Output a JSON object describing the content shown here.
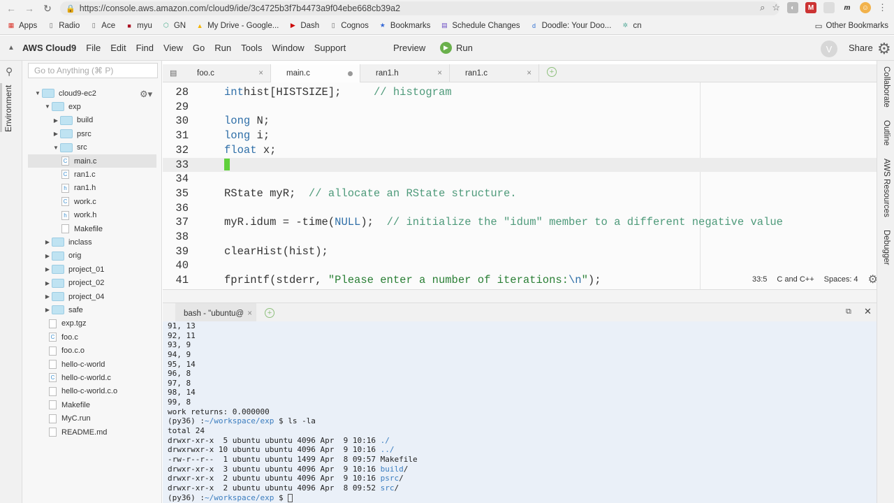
{
  "browser": {
    "url": "https://console.aws.amazon.com/cloud9/ide/3c4725b3f7b4473a9f04ebe668cb39a2",
    "bookmarks": [
      "Apps",
      "Radio",
      "Ace",
      "myu",
      "GN",
      "My Drive - Google...",
      "Dash",
      "Cognos",
      "Bookmarks",
      "Schedule Changes",
      "Doodle: Your Doo...",
      "cn"
    ],
    "other_bookmarks": "Other Bookmarks"
  },
  "menubar": {
    "brand": "AWS Cloud9",
    "menus": [
      "File",
      "Edit",
      "Find",
      "View",
      "Go",
      "Run",
      "Tools",
      "Window",
      "Support"
    ],
    "preview": "Preview",
    "run": "Run",
    "avatar": "V",
    "share": "Share"
  },
  "leftrail": {
    "environment": "Environment"
  },
  "tree": {
    "goto_placeholder": "Go to Anything (⌘ P)",
    "items": [
      {
        "label": "cloud9-ec2",
        "type": "folder",
        "arrow": "▼"
      },
      {
        "label": "exp",
        "type": "folder",
        "arrow": "▼"
      },
      {
        "label": "build",
        "type": "folder",
        "arrow": "▶"
      },
      {
        "label": "psrc",
        "type": "folder",
        "arrow": "▶"
      },
      {
        "label": "src",
        "type": "folder",
        "arrow": "▼"
      },
      {
        "label": "main.c",
        "type": "c"
      },
      {
        "label": "ran1.c",
        "type": "c"
      },
      {
        "label": "ran1.h",
        "type": "h"
      },
      {
        "label": "work.c",
        "type": "c"
      },
      {
        "label": "work.h",
        "type": "h"
      },
      {
        "label": "Makefile",
        "type": "file"
      },
      {
        "label": "inclass",
        "type": "folder",
        "arrow": "▶"
      },
      {
        "label": "orig",
        "type": "folder",
        "arrow": "▶"
      },
      {
        "label": "project_01",
        "type": "folder",
        "arrow": "▶"
      },
      {
        "label": "project_02",
        "type": "folder",
        "arrow": "▶"
      },
      {
        "label": "project_04",
        "type": "folder",
        "arrow": "▶"
      },
      {
        "label": "safe",
        "type": "folder",
        "arrow": "▶"
      },
      {
        "label": "exp.tgz",
        "type": "file"
      },
      {
        "label": "foo.c",
        "type": "c"
      },
      {
        "label": "foo.c.o",
        "type": "file"
      },
      {
        "label": "hello-c-world",
        "type": "file"
      },
      {
        "label": "hello-c-world.c",
        "type": "c"
      },
      {
        "label": "hello-c-world.c.o",
        "type": "file"
      },
      {
        "label": "Makefile",
        "type": "file"
      },
      {
        "label": "MyC.run",
        "type": "file"
      },
      {
        "label": "README.md",
        "type": "file"
      }
    ]
  },
  "editor": {
    "tabs": [
      "foo.c",
      "main.c",
      "ran1.h",
      "ran1.c"
    ],
    "active_tab": "main.c",
    "lines": [
      {
        "n": "28",
        "segs": [
          [
            "kw",
            "int"
          ],
          [
            "",
            "hist[HISTSIZE];     "
          ],
          [
            "cm",
            "// histogram"
          ]
        ]
      },
      {
        "n": "29",
        "segs": []
      },
      {
        "n": "30",
        "segs": [
          [
            "kw",
            "long"
          ],
          [
            "",
            " N;"
          ]
        ]
      },
      {
        "n": "31",
        "segs": [
          [
            "kw",
            "long"
          ],
          [
            "",
            " i;"
          ]
        ]
      },
      {
        "n": "32",
        "segs": [
          [
            "kw",
            "float"
          ],
          [
            "",
            " x;"
          ]
        ]
      },
      {
        "n": "33",
        "segs": [],
        "cursor": true
      },
      {
        "n": "34",
        "segs": []
      },
      {
        "n": "35",
        "segs": [
          [
            "",
            "RState myR;  "
          ],
          [
            "cm",
            "// allocate an RState structure."
          ]
        ]
      },
      {
        "n": "36",
        "segs": []
      },
      {
        "n": "37",
        "segs": [
          [
            "",
            "myR.idum = -time("
          ],
          [
            "kw",
            "NULL"
          ],
          [
            "",
            ");  "
          ],
          [
            "cm",
            "// initialize the \"idum\" member to a different negative value"
          ]
        ]
      },
      {
        "n": "38",
        "segs": []
      },
      {
        "n": "39",
        "segs": [
          [
            "",
            "clearHist(hist);"
          ]
        ]
      },
      {
        "n": "40",
        "segs": []
      },
      {
        "n": "41",
        "segs": [
          [
            "",
            "fprintf(stderr, "
          ],
          [
            "str",
            "\"Please enter a number of iterations:"
          ],
          [
            "kw",
            "\\n"
          ],
          [
            "str",
            "\""
          ],
          [
            "",
            ");"
          ]
        ]
      }
    ],
    "status": {
      "position": "33:5",
      "language": "C and C++",
      "spaces": "Spaces: 4"
    }
  },
  "terminal": {
    "tab": "bash - \"ubuntu@",
    "lines": [
      [
        [
          "",
          "91, 13"
        ]
      ],
      [
        [
          "",
          "92, 11"
        ]
      ],
      [
        [
          "",
          "93, 9"
        ]
      ],
      [
        [
          "",
          "94, 9"
        ]
      ],
      [
        [
          "",
          "95, 14"
        ]
      ],
      [
        [
          "",
          "96, 8"
        ]
      ],
      [
        [
          "",
          "97, 8"
        ]
      ],
      [
        [
          "",
          "98, 14"
        ]
      ],
      [
        [
          "",
          "99, 8"
        ]
      ],
      [
        [
          "",
          "work returns: 0.000000"
        ]
      ],
      [
        [
          "",
          "(py36) :"
        ],
        [
          "d",
          "~/workspace/exp"
        ],
        [
          "",
          " $ ls -la"
        ]
      ],
      [
        [
          "",
          "total 24"
        ]
      ],
      [
        [
          "",
          "drwxr-xr-x  5 ubuntu ubuntu 4096 Apr  9 10:16 "
        ],
        [
          "d",
          "./"
        ]
      ],
      [
        [
          "",
          "drwxrwxr-x 10 ubuntu ubuntu 4096 Apr  9 10:16 "
        ],
        [
          "d",
          "../"
        ]
      ],
      [
        [
          "",
          "-rw-r--r--  1 ubuntu ubuntu 1499 Apr  8 09:57 Makefile"
        ]
      ],
      [
        [
          "",
          "drwxr-xr-x  3 ubuntu ubuntu 4096 Apr  9 10:16 "
        ],
        [
          "d",
          "build"
        ],
        [
          "",
          "/"
        ]
      ],
      [
        [
          "",
          "drwxr-xr-x  2 ubuntu ubuntu 4096 Apr  9 10:16 "
        ],
        [
          "d",
          "psrc"
        ],
        [
          "",
          "/"
        ]
      ],
      [
        [
          "",
          "drwxr-xr-x  2 ubuntu ubuntu 4096 Apr  8 09:52 "
        ],
        [
          "d",
          "src"
        ],
        [
          "",
          "/"
        ]
      ],
      [
        [
          "",
          "(py36) :"
        ],
        [
          "d",
          "~/workspace/exp"
        ],
        [
          "",
          " $ "
        ]
      ]
    ]
  },
  "rightrail": [
    "Collaborate",
    "Outline",
    "AWS Resources",
    "Debugger"
  ]
}
